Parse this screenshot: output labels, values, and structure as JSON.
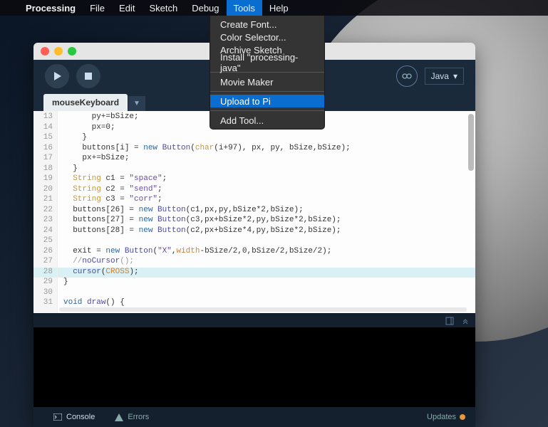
{
  "menubar": {
    "apple": "",
    "app": "Processing",
    "items": [
      "File",
      "Edit",
      "Sketch",
      "Debug",
      "Tools",
      "Help"
    ],
    "open_index": 4
  },
  "dropdown": {
    "groups": [
      [
        "Create Font...",
        "Color Selector...",
        "Archive Sketch",
        "Install \"processing-java\""
      ],
      [
        "Movie Maker"
      ],
      [
        "Upload to Pi"
      ],
      [
        "Add Tool..."
      ]
    ],
    "highlight": "Upload to Pi"
  },
  "window": {
    "title": "mouseKeyboard",
    "tab": "mouseKeyboard",
    "language": "Java",
    "console_tab": "Console",
    "errors_tab": "Errors",
    "updates": "Updates"
  },
  "code": {
    "first_line": 13,
    "highlight_line": 28,
    "lines": [
      "      py+=bSize;",
      "      px=0;",
      "    }",
      "    buttons[i] = new Button(char(i+97), px, py, bSize,bSize);",
      "    px+=bSize;",
      "  }",
      "  String c1 = \"space\";",
      "  String c2 = \"send\";",
      "  String c3 = \"corr\";",
      "  buttons[26] = new Button(c1,px,py,bSize*2,bSize);",
      "  buttons[27] = new Button(c3,px+bSize*2,py,bSize*2,bSize);",
      "  buttons[28] = new Button(c2,px+bSize*4,py,bSize*2,bSize);",
      "",
      "  exit = new Button(\"X\",width-bSize/2,0,bSize/2,bSize/2);",
      "  //noCursor();",
      "  cursor(CROSS);",
      "}",
      "",
      "void draw() {"
    ]
  }
}
